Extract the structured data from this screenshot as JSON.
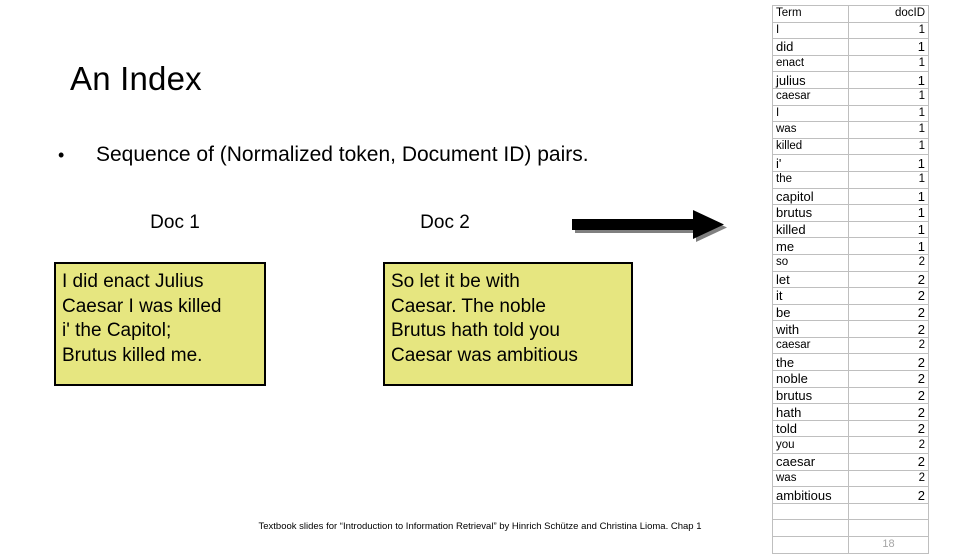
{
  "slide": {
    "title": "An Index",
    "bullet_marker": "•",
    "bullet_text": "Sequence of (Normalized token, Document ID) pairs.",
    "footer": "Textbook slides for “Introduction to Information Retrieval” by Hinrich Schütze and Christina Lioma. Chap 1",
    "page_number": "18",
    "arrow_icon": "right-arrow-icon",
    "accent_box_color": "#E6E680",
    "box_border_color": "#000000",
    "table_grid_color": "#BFBFBF",
    "page_number_color": "#A6A6A6"
  },
  "documents": [
    {
      "label": "Doc 1",
      "lines": [
        "I did enact Julius",
        "Caesar I was killed",
        "i' the Capitol;",
        "Brutus killed me."
      ]
    },
    {
      "label": "Doc 2",
      "lines": [
        "So let it be with",
        "Caesar. The noble",
        "Brutus hath told you",
        "Caesar was ambitious"
      ]
    }
  ],
  "index_table": {
    "headers": [
      "Term",
      "docID"
    ],
    "rows": [
      {
        "term": "I",
        "docID": "1",
        "emphasis": false
      },
      {
        "term": "did",
        "docID": "1",
        "emphasis": true
      },
      {
        "term": "enact",
        "docID": "1",
        "emphasis": false
      },
      {
        "term": "julius",
        "docID": "1",
        "emphasis": true
      },
      {
        "term": "caesar",
        "docID": "1",
        "emphasis": false
      },
      {
        "term": "I",
        "docID": "1",
        "emphasis": false
      },
      {
        "term": "was",
        "docID": "1",
        "emphasis": false
      },
      {
        "term": "killed",
        "docID": "1",
        "emphasis": false
      },
      {
        "term": "i'",
        "docID": "1",
        "emphasis": true
      },
      {
        "term": "the",
        "docID": "1",
        "emphasis": false
      },
      {
        "term": "capitol",
        "docID": "1",
        "emphasis": true
      },
      {
        "term": "brutus",
        "docID": "1",
        "emphasis": true
      },
      {
        "term": "killed",
        "docID": "1",
        "emphasis": true
      },
      {
        "term": "me",
        "docID": "1",
        "emphasis": true
      },
      {
        "term": "so",
        "docID": "2",
        "emphasis": false
      },
      {
        "term": "let",
        "docID": "2",
        "emphasis": true
      },
      {
        "term": "it",
        "docID": "2",
        "emphasis": true
      },
      {
        "term": "be",
        "docID": "2",
        "emphasis": true
      },
      {
        "term": "with",
        "docID": "2",
        "emphasis": true
      },
      {
        "term": "caesar",
        "docID": "2",
        "emphasis": false
      },
      {
        "term": "the",
        "docID": "2",
        "emphasis": true
      },
      {
        "term": "noble",
        "docID": "2",
        "emphasis": true
      },
      {
        "term": "brutus",
        "docID": "2",
        "emphasis": true
      },
      {
        "term": "hath",
        "docID": "2",
        "emphasis": true
      },
      {
        "term": "told",
        "docID": "2",
        "emphasis": true
      },
      {
        "term": "you",
        "docID": "2",
        "emphasis": false
      },
      {
        "term": "caesar",
        "docID": "2",
        "emphasis": true
      },
      {
        "term": "was",
        "docID": "2",
        "emphasis": false
      },
      {
        "term": "ambitious",
        "docID": "2",
        "emphasis": true
      }
    ],
    "trailing_empty_rows": 2
  }
}
